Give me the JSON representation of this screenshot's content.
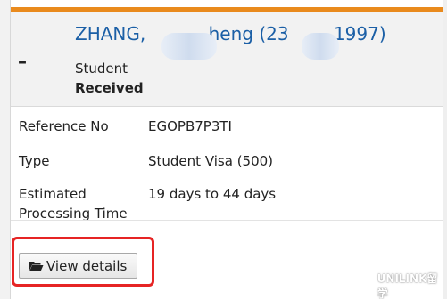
{
  "applicant": {
    "name": "ZHANG,",
    "name_middle": "heng (23",
    "name_end": "1997)",
    "type": "Student",
    "status": "Received"
  },
  "details": {
    "reference_label": "Reference No",
    "reference_value": "EGOPB7P3TI",
    "type_label": "Type",
    "type_value": "Student Visa (500)",
    "time_label": "Estimated Processing Time",
    "time_value": "19 days to 44 days"
  },
  "actions": {
    "view_details_label": "View details"
  },
  "watermark": {
    "text": "UNILINK留学"
  },
  "colors": {
    "accent": "#e98a1d",
    "name_link": "#1b5fa6",
    "highlight": "#e62424"
  },
  "icons": {
    "collapse": "minus-icon",
    "button": "folder-open-icon",
    "watermark": "wechat-icon"
  }
}
